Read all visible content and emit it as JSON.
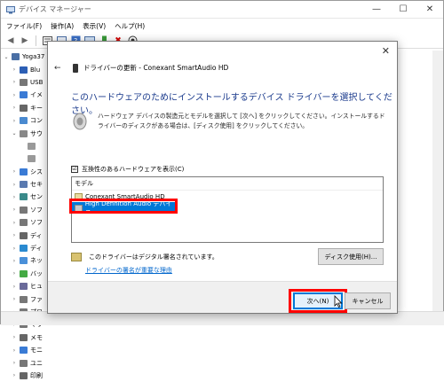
{
  "device_manager": {
    "title": "デバイス マネージャー",
    "menu": [
      "ファイル(F)",
      "操作(A)",
      "表示(V)",
      "ヘルプ(H)"
    ],
    "toolbar_icons": [
      "back-icon",
      "forward-icon",
      "properties-icon",
      "show-hidden-icon",
      "help-icon",
      "computer-icon",
      "update-driver-icon",
      "uninstall-icon",
      "scan-icon"
    ],
    "tree": [
      {
        "label": "Yoga37",
        "expanded": true,
        "level": 0,
        "color": "#4a6fa5"
      },
      {
        "label": "Blu",
        "level": 1,
        "color": "#2c5fb5"
      },
      {
        "label": "USB",
        "level": 1,
        "color": "#777777"
      },
      {
        "label": "イメ",
        "level": 1,
        "color": "#3a7bd5"
      },
      {
        "label": "キー",
        "level": 1,
        "color": "#666666"
      },
      {
        "label": "コン",
        "level": 1,
        "color": "#4a8ad0"
      },
      {
        "label": "サウ",
        "level": 1,
        "expanded": true,
        "color": "#888888"
      },
      {
        "label": "",
        "level": 2,
        "color": "#999999"
      },
      {
        "label": "",
        "level": 2,
        "color": "#999999"
      },
      {
        "label": "シス",
        "level": 1,
        "color": "#3a7bd5"
      },
      {
        "label": "セキ",
        "level": 1,
        "color": "#5a7ab0"
      },
      {
        "label": "セン",
        "level": 1,
        "color": "#3a8a8a"
      },
      {
        "label": "ソフ",
        "level": 1,
        "color": "#777777"
      },
      {
        "label": "ソフ",
        "level": 1,
        "color": "#777777"
      },
      {
        "label": "ディ",
        "level": 1,
        "color": "#666666"
      },
      {
        "label": "ディ",
        "level": 1,
        "color": "#2a8ad0"
      },
      {
        "label": "ネッ",
        "level": 1,
        "color": "#4a90d9"
      },
      {
        "label": "バッ",
        "level": 1,
        "color": "#44aa44"
      },
      {
        "label": "ヒュ",
        "level": 1,
        "color": "#6a6a9a"
      },
      {
        "label": "ファ",
        "level": 1,
        "color": "#777777"
      },
      {
        "label": "プロ",
        "level": 1,
        "color": "#777777"
      },
      {
        "label": "マウ",
        "level": 1,
        "color": "#777777"
      },
      {
        "label": "メモ",
        "level": 1,
        "color": "#666666"
      },
      {
        "label": "モニ",
        "level": 1,
        "color": "#3a7bd5"
      },
      {
        "label": "ユニ",
        "level": 1,
        "color": "#777777"
      },
      {
        "label": "印刷",
        "level": 1,
        "color": "#666666"
      }
    ]
  },
  "dialog": {
    "header_title": "ドライバーの更新 - Conexant SmartAudio HD",
    "main_title": "このハードウェアのためにインストールするデバイス ドライバーを選択してください。",
    "description": "ハードウェア デバイスの製造元とモデルを選択して [次へ] をクリックしてください。インストールするドライバーのディスクがある場合は、[ディスク使用] をクリックしてください。",
    "compat_label": "互換性のあるハードウェアを表示(C)",
    "compat_checked": "☑",
    "model_header": "モデル",
    "models": [
      "Conexant SmartAudio HD",
      "High Definition Audio デバイス"
    ],
    "signed_text": "このドライバーはデジタル署名されています。",
    "signing_link": "ドライバーの署名が重要な理由",
    "disk_button": "ディスク使用(H)...",
    "next_button": "次へ(N)",
    "cancel_button": "キャンセル",
    "close_glyph": "✕",
    "back_glyph": "←"
  },
  "colors": {
    "title_blue": "#1a3a8c",
    "selection_blue": "#0078d7",
    "annotation_red": "#ff0000",
    "link_blue": "#0066cc"
  }
}
